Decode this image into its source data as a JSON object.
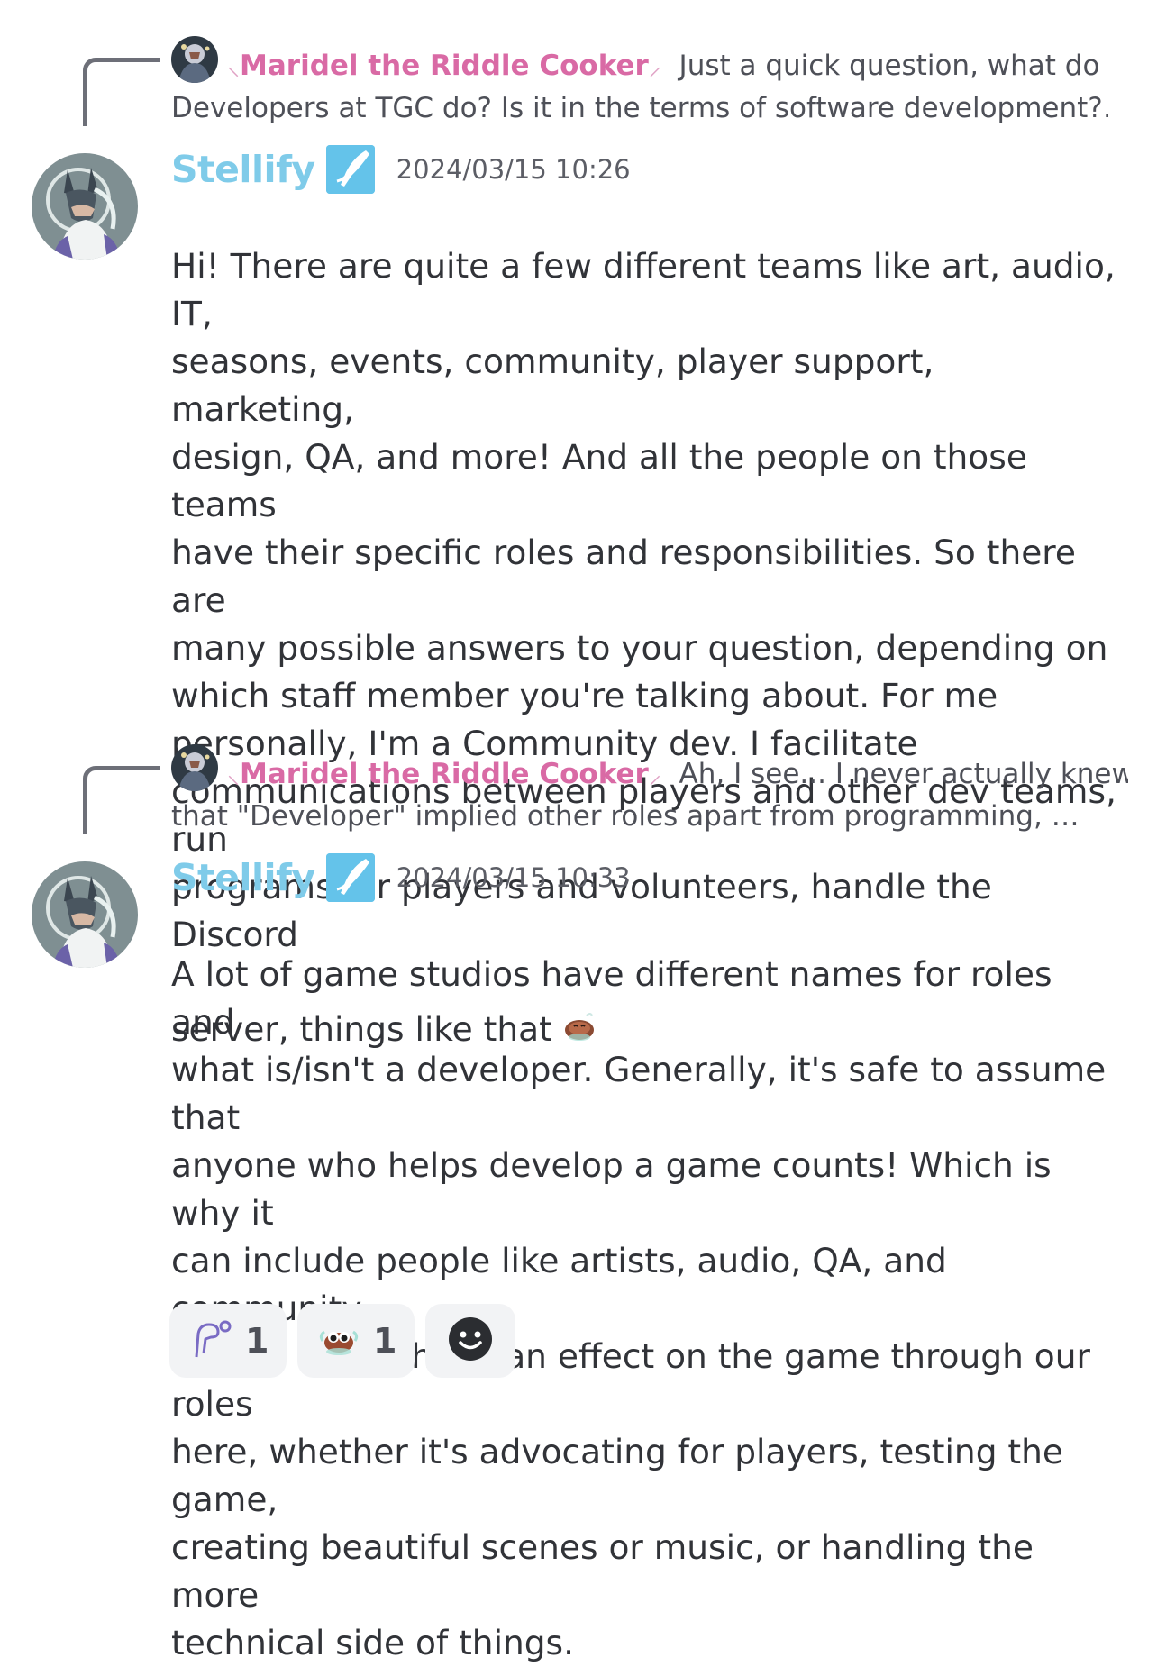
{
  "messages": [
    {
      "reply": {
        "author": "Maridel the Riddle Cooker",
        "line1": "Just a quick question, what do",
        "line2": "Developers at TGC do? Is it in the terms of software development?…"
      },
      "author": "Stellify",
      "timestamp": "2024/03/15 10:26",
      "content": "Hi! There are quite a few different teams like art, audio, IT,\nseasons, events, community, player support, marketing,\ndesign, QA, and more! And all the people on those teams\nhave their specific roles and responsibilities. So there are\nmany possible answers to your question, depending on\nwhich staff member you're talking about. For me\npersonally, I'm a Community dev. I facilitate\ncommunications between players and other dev teams, run\nprograms for players and volunteers, handle the Discord\nserver, things like that"
    },
    {
      "reply": {
        "author": "Maridel the Riddle Cooker",
        "line1": "Ah, I see... I never actually knew",
        "line2": "that \"Developer\" implied other roles apart from programming, …"
      },
      "author": "Stellify",
      "timestamp": "2024/03/15 10:33",
      "content": "A lot of game studios have different names for roles and\nwhat is/isn't a developer. Generally, it's safe to assume that\nanyone who helps develop a game counts! Which is why it\ncan include people like artists, audio, QA, and community\nteams. We all have an effect on the game through our roles\nhere, whether it's advocating for players, testing the game,\ncreating beautiful scenes or music, or handling the more\ntechnical side of things."
    }
  ],
  "reactions": [
    {
      "icon": "wind-swirl-icon",
      "count": "1"
    },
    {
      "icon": "crab-emoji-icon",
      "count": "1"
    },
    {
      "icon": "add-reaction-icon"
    }
  ],
  "colors": {
    "reply_author": "#d96aa5",
    "author": "#7fcbe9",
    "role_badge": "#64c3ea",
    "reaction_bg": "#f2f3f5"
  }
}
